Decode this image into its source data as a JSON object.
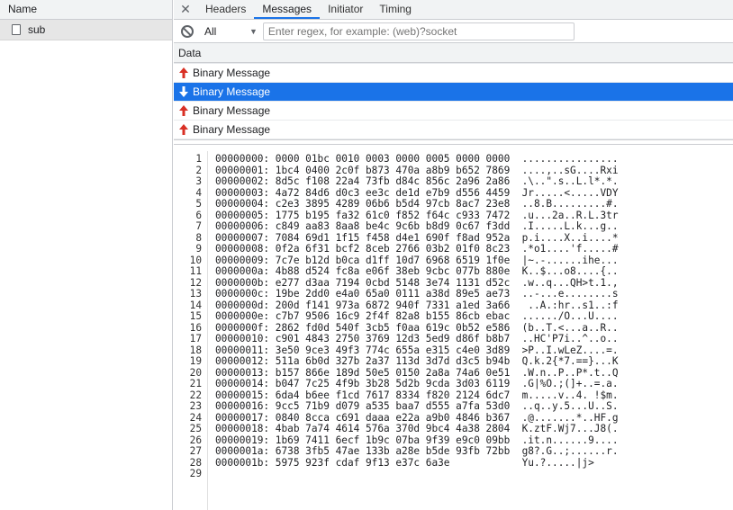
{
  "left": {
    "header": "Name",
    "items": [
      {
        "label": "sub"
      }
    ]
  },
  "tabs": [
    {
      "label": "Headers",
      "active": false
    },
    {
      "label": "Messages",
      "active": true
    },
    {
      "label": "Initiator",
      "active": false
    },
    {
      "label": "Timing",
      "active": false
    }
  ],
  "filter": {
    "select_value": "All",
    "placeholder": "Enter regex, for example: (web)?socket"
  },
  "data_header": "Data",
  "messages": [
    {
      "label": "Binary Message",
      "direction": "up",
      "selected": false
    },
    {
      "label": "Binary Message",
      "direction": "down",
      "selected": true
    },
    {
      "label": "Binary Message",
      "direction": "up",
      "selected": false
    },
    {
      "label": "Binary Message",
      "direction": "up",
      "selected": false
    }
  ],
  "colors": {
    "up_arrow": "#d93025",
    "selected_bg": "#1a73e8",
    "tab_underline": "#1a73e8"
  },
  "hex_lines": [
    "00000000: 0000 01bc 0010 0003 0000 0005 0000 0000  ................",
    "00000001: 1bc4 0400 2c0f b873 470a a8b9 b652 7869  ....,..sG....Rxi",
    "00000002: 8d5c f108 22a4 73fb d84c 856c 2a96 2a86  .\\..\".s..L.l*.*.",
    "00000003: 4a72 84d6 d0c3 ee3c de1d e7b9 d556 4459  Jr.....<.....VDY",
    "00000004: c2e3 3895 4289 06b6 b5d4 97cb 8ac7 23e8  ..8.B.........#.",
    "00000005: 1775 b195 fa32 61c0 f852 f64c c933 7472  .u...2a..R.L.3tr",
    "00000006: c849 aa83 8aa8 be4c 9c6b b8d9 0c67 f3dd  .I.....L.k...g..",
    "00000007: 7084 69d1 1f15 f458 d4e1 690f f8ad 952a  p.i....X..i....*",
    "00000008: 0f2a 6f31 bcf2 8ceb 2766 03b2 01f0 8c23  .*o1....'f.....#",
    "00000009: 7c7e b12d b0ca d1ff 10d7 6968 6519 1f0e  |~.-......ihe...",
    "0000000a: 4b88 d524 fc8a e06f 38eb 9cbc 077b 880e  K..$...o8....{..",
    "0000000b: e277 d3aa 7194 0cbd 5148 3e74 1131 d52c  .w..q...QH>t.1.,",
    "0000000c: 19be 2dd0 e4a0 65a0 0111 a38d 89e5 ae73  ..-...e........s",
    "0000000d: 200d f141 973a 6872 940f 7331 a1ed 3a66   ..A.:hr..s1..:f",
    "0000000e: c7b7 9506 16c9 2f4f 82a8 b155 86cb ebac  ....../O...U....",
    "0000000f: 2862 fd0d 540f 3cb5 f0aa 619c 0b52 e586  (b..T.<...a..R..",
    "00000010: c901 4843 2750 3769 12d3 5ed9 d86f b8b7  ..HC'P7i..^..o..",
    "00000011: 3e50 9ce3 49f3 774c 655a e315 c4e0 3d89  >P..I.wLeZ....=.",
    "00000012: 511a 6b0d 327b 2a37 113d 3d7d d3c5 b94b  Q.k.2{*7.==}...K",
    "00000013: b157 866e 189d 50e5 0150 2a8a 74a6 0e51  .W.n..P..P*.t..Q",
    "00000014: b047 7c25 4f9b 3b28 5d2b 9cda 3d03 6119  .G|%O.;(]+..=.a.",
    "00000015: 6da4 b6ee f1cd 7617 8334 f820 2124 6dc7  m.....v..4. !$m.",
    "00000016: 9cc5 71b9 d079 a535 baa7 d555 a7fa 53d0  ..q..y.5...U..S.",
    "00000017: 0840 8cca c691 daaa e22a a9b0 4846 b367  .@.......*..HF.g",
    "00000018: 4bab 7a74 4614 576a 370d 9bc4 4a38 2804  K.ztF.Wj7...J8(.",
    "00000019: 1b69 7411 6ecf 1b9c 07ba 9f39 e9c0 09bb  .it.n......9....",
    "0000001a: 6738 3fb5 47ae 133b a28e b5de 93fb 72bb  g8?.G..;......r.",
    "0000001b: 5975 923f cdaf 9f13 e37c 6a3e            Yu.?.....|j>",
    ""
  ]
}
